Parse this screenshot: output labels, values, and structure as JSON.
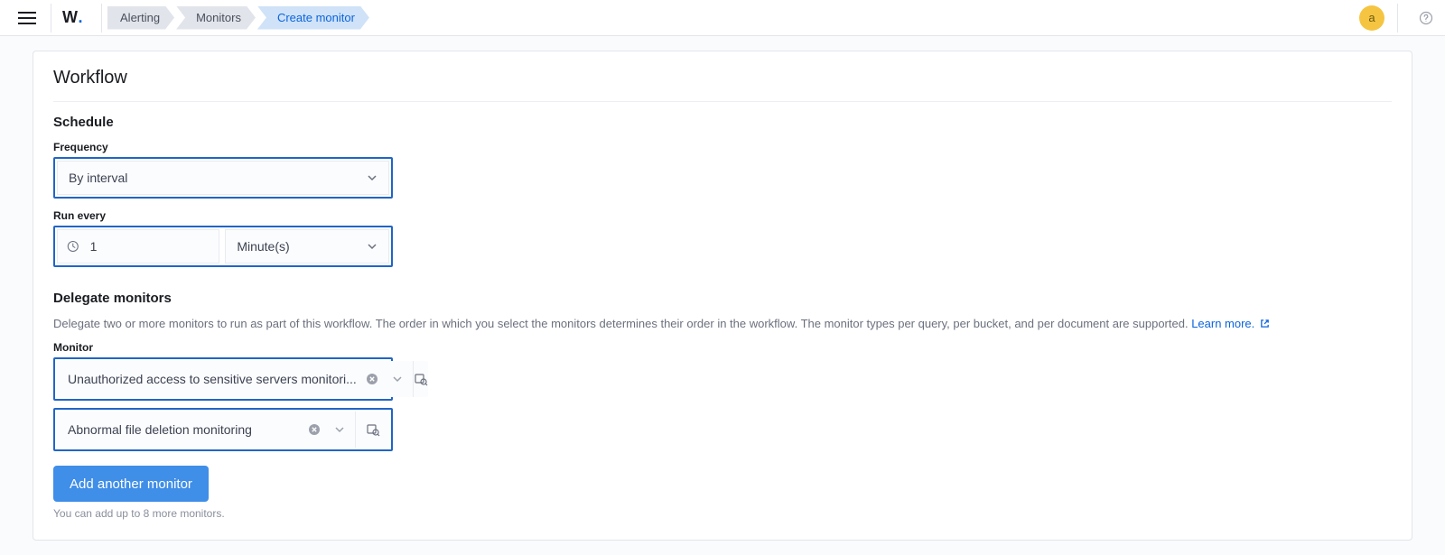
{
  "topbar": {
    "logo_text": "W",
    "avatar_initial": "a"
  },
  "breadcrumbs": [
    {
      "label": "Alerting",
      "active": false
    },
    {
      "label": "Monitors",
      "active": false
    },
    {
      "label": "Create monitor",
      "active": true
    }
  ],
  "panel": {
    "title": "Workflow"
  },
  "schedule": {
    "heading": "Schedule",
    "frequency_label": "Frequency",
    "frequency_value": "By interval",
    "run_every_label": "Run every",
    "run_every_value": "1",
    "run_every_unit": "Minute(s)"
  },
  "delegate": {
    "heading": "Delegate monitors",
    "description": "Delegate two or more monitors to run as part of this workflow. The order in which you select the monitors determines their order in the workflow. The monitor types per query, per bucket, and per document are supported. ",
    "learn_more": "Learn more.",
    "monitor_label": "Monitor",
    "monitors": [
      "Unauthorized access to sensitive servers monitori...",
      "Abnormal file deletion monitoring"
    ],
    "add_button": "Add another monitor",
    "add_hint": "You can add up to 8 more monitors."
  }
}
